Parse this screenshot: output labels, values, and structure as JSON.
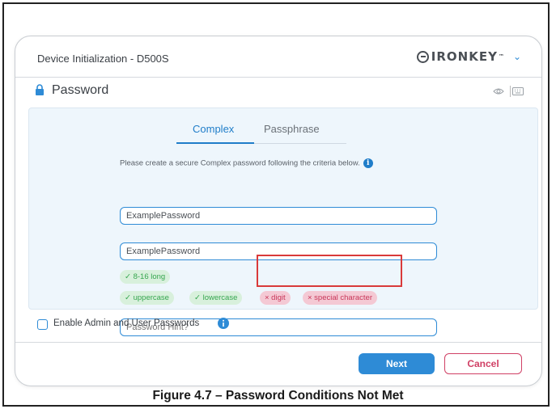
{
  "dialog": {
    "title": "Device Initialization - D500S",
    "brand": "IRONKEY",
    "brand_tm": "™",
    "brand_menu_icon": "chevron-down-icon"
  },
  "section": {
    "title": "Password",
    "icon": "lock-icon",
    "tool_icons": [
      "eye-icon",
      "keyboard-icon"
    ]
  },
  "tabs": [
    {
      "label": "Complex",
      "active": true
    },
    {
      "label": "Passphrase",
      "active": false
    }
  ],
  "form": {
    "instruction": "Please create a secure Complex password following the criteria below.",
    "password_value": "ExamplePassword",
    "confirm_value": "ExamplePassword",
    "hint_placeholder": "Password Hint?"
  },
  "criteria": [
    {
      "label": "✓ 8-16 long",
      "met": true
    },
    {
      "label": "✓ uppercase",
      "met": true
    },
    {
      "label": "✓ lowercase",
      "met": true
    },
    {
      "label": "× digit",
      "met": false
    },
    {
      "label": "× special character",
      "met": false
    }
  ],
  "options": {
    "admin_user_label": "Enable Admin and User Passwords",
    "admin_user_checked": false
  },
  "buttons": {
    "next": "Next",
    "cancel": "Cancel"
  },
  "caption": "Figure 4.7 – Password Conditions Not Met",
  "colors": {
    "accent": "#2e8bd6",
    "success": "#36a64f",
    "error": "#c8375a",
    "highlight": "#d93a3a"
  }
}
